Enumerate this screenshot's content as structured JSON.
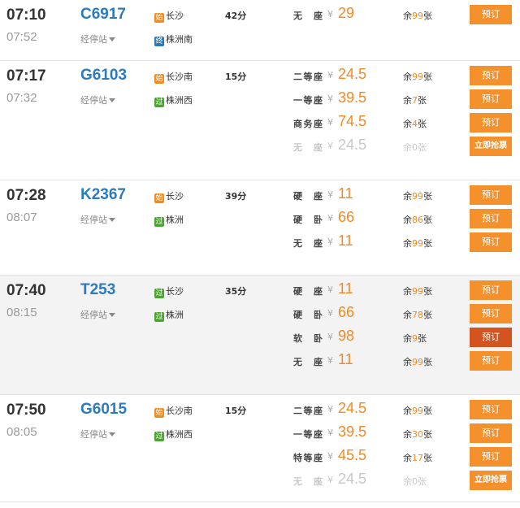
{
  "labels": {
    "stops": "经停站"
  },
  "colors": {
    "accent": "#f08a24",
    "train_code": "#2b7bc0",
    "badge_start": "#f28b1e",
    "badge_pass": "#4aa52f",
    "badge_end": "#2b78b6"
  },
  "trains": [
    {
      "code": "C6917",
      "depart": "07:10",
      "arrive": "07:52",
      "duration": "42分",
      "from": {
        "badge": "始",
        "type": "start",
        "name": "长沙"
      },
      "to": {
        "badge": "终",
        "type": "end",
        "name": "株洲南"
      },
      "seats": [
        {
          "name": "无座",
          "yen": "¥",
          "price": "29",
          "left_prefix": "余",
          "left_num": "99",
          "left_unit": "张",
          "button": "预订",
          "available": true
        }
      ]
    },
    {
      "code": "G6103",
      "depart": "07:17",
      "arrive": "07:32",
      "duration": "15分",
      "from": {
        "badge": "始",
        "type": "start",
        "name": "长沙南"
      },
      "to": {
        "badge": "过",
        "type": "pass",
        "name": "株洲西"
      },
      "seats": [
        {
          "name": "二等座",
          "yen": "¥",
          "price": "24.5",
          "left_prefix": "余",
          "left_num": "99",
          "left_unit": "张",
          "button": "预订",
          "available": true
        },
        {
          "name": "一等座",
          "yen": "¥",
          "price": "39.5",
          "left_prefix": "余",
          "left_num": "7",
          "left_unit": "张",
          "button": "预订",
          "available": true
        },
        {
          "name": "商务座",
          "yen": "¥",
          "price": "74.5",
          "left_prefix": "余",
          "left_num": "4",
          "left_unit": "张",
          "button": "预订",
          "available": true
        },
        {
          "name": "无座",
          "yen": "¥",
          "price": "24.5",
          "left_prefix": "余",
          "left_num": "0",
          "left_unit": "张",
          "button": "立即抢票",
          "available": false
        }
      ]
    },
    {
      "code": "K2367",
      "depart": "07:28",
      "arrive": "08:07",
      "duration": "39分",
      "from": {
        "badge": "始",
        "type": "start",
        "name": "长沙"
      },
      "to": {
        "badge": "过",
        "type": "pass",
        "name": "株洲"
      },
      "seats": [
        {
          "name": "硬座",
          "yen": "¥",
          "price": "11",
          "left_prefix": "余",
          "left_num": "99",
          "left_unit": "张",
          "button": "预订",
          "available": true
        },
        {
          "name": "硬卧",
          "yen": "¥",
          "price": "66",
          "left_prefix": "余",
          "left_num": "86",
          "left_unit": "张",
          "button": "预订",
          "available": true
        },
        {
          "name": "无座",
          "yen": "¥",
          "price": "11",
          "left_prefix": "余",
          "left_num": "99",
          "left_unit": "张",
          "button": "预订",
          "available": true
        }
      ]
    },
    {
      "code": "T253",
      "depart": "07:40",
      "arrive": "08:15",
      "duration": "35分",
      "highlight": true,
      "from": {
        "badge": "过",
        "type": "pass",
        "name": "长沙"
      },
      "to": {
        "badge": "过",
        "type": "pass",
        "name": "株洲"
      },
      "seats": [
        {
          "name": "硬座",
          "yen": "¥",
          "price": "11",
          "left_prefix": "余",
          "left_num": "99",
          "left_unit": "张",
          "button": "预订",
          "available": true
        },
        {
          "name": "硬卧",
          "yen": "¥",
          "price": "66",
          "left_prefix": "余",
          "left_num": "78",
          "left_unit": "张",
          "button": "预订",
          "available": true
        },
        {
          "name": "软卧",
          "yen": "¥",
          "price": "98",
          "left_prefix": "余",
          "left_num": "9",
          "left_unit": "张",
          "button": "预订",
          "available": true,
          "active": true
        },
        {
          "name": "无座",
          "yen": "¥",
          "price": "11",
          "left_prefix": "余",
          "left_num": "99",
          "left_unit": "张",
          "button": "预订",
          "available": true
        }
      ]
    },
    {
      "code": "G6015",
      "depart": "07:50",
      "arrive": "08:05",
      "duration": "15分",
      "from": {
        "badge": "始",
        "type": "start",
        "name": "长沙南"
      },
      "to": {
        "badge": "过",
        "type": "pass",
        "name": "株洲西"
      },
      "seats": [
        {
          "name": "二等座",
          "yen": "¥",
          "price": "24.5",
          "left_prefix": "余",
          "left_num": "99",
          "left_unit": "张",
          "button": "预订",
          "available": true
        },
        {
          "name": "一等座",
          "yen": "¥",
          "price": "39.5",
          "left_prefix": "余",
          "left_num": "30",
          "left_unit": "张",
          "button": "预订",
          "available": true
        },
        {
          "name": "特等座",
          "yen": "¥",
          "price": "45.5",
          "left_prefix": "余",
          "left_num": "17",
          "left_unit": "张",
          "button": "预订",
          "available": true
        },
        {
          "name": "无座",
          "yen": "¥",
          "price": "24.5",
          "left_prefix": "余",
          "left_num": "0",
          "left_unit": "张",
          "button": "立即抢票",
          "available": false
        }
      ]
    }
  ]
}
